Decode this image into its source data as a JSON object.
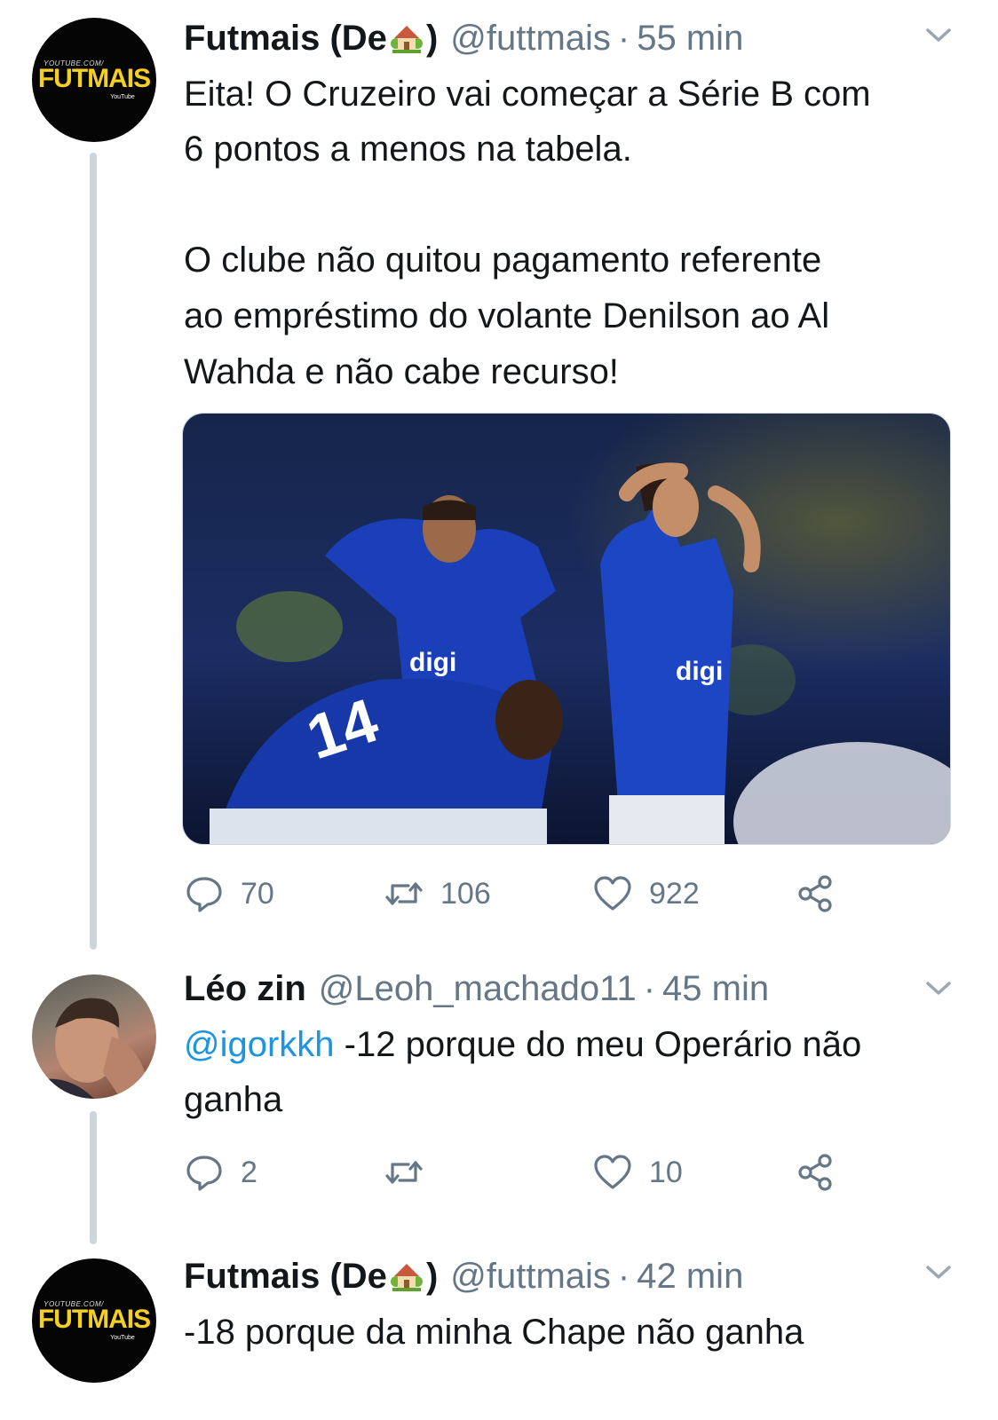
{
  "tweets": [
    {
      "name": "Futmais (De",
      "name_close": ")",
      "name_emoji_icon": "house-with-garden-icon",
      "handle": "@futtmais",
      "separator": "·",
      "time": "55 min",
      "avatar": {
        "brand": "FUTMAIS",
        "top_text": "YOUTUBE.COM/",
        "bottom_text": "YouTube"
      },
      "text_lines": [
        "Eita! O Cruzeiro vai começar a Série B com",
        "6 pontos a menos na tabela.",
        "O clube não quitou pagamento referente",
        "ao empréstimo do volante Denilson ao Al",
        "Wahda e não cabe recurso!"
      ],
      "media": {
        "shirt_sponsor": "digi",
        "shirt_number": "14"
      },
      "replies": "70",
      "retweets": "106",
      "likes": "922"
    },
    {
      "name": "Léo zin",
      "handle": "@Leoh_machado11",
      "separator": "·",
      "time": "45 min",
      "mention": "@igorkkh",
      "text_after_mention": " -12 porque do meu Operário não",
      "text_line_2": "ganha",
      "replies": "2",
      "retweets": "",
      "likes": "10"
    },
    {
      "name": "Futmais (De",
      "name_close": ")",
      "name_emoji_icon": "house-with-garden-icon",
      "handle": "@futtmais",
      "separator": "·",
      "time": "42 min",
      "avatar": {
        "brand": "FUTMAIS",
        "top_text": "YOUTUBE.COM/",
        "bottom_text": "YouTube"
      },
      "text_lines": [
        "-18 porque da minha Chape não ganha"
      ]
    }
  ],
  "colors": {
    "text": "#14171a",
    "secondary": "#657786",
    "link": "#1b95e0",
    "thread_line": "#ccd6dd",
    "cruzeiro_blue": "#1a3fb8",
    "brand_yellow": "#f5d021"
  }
}
